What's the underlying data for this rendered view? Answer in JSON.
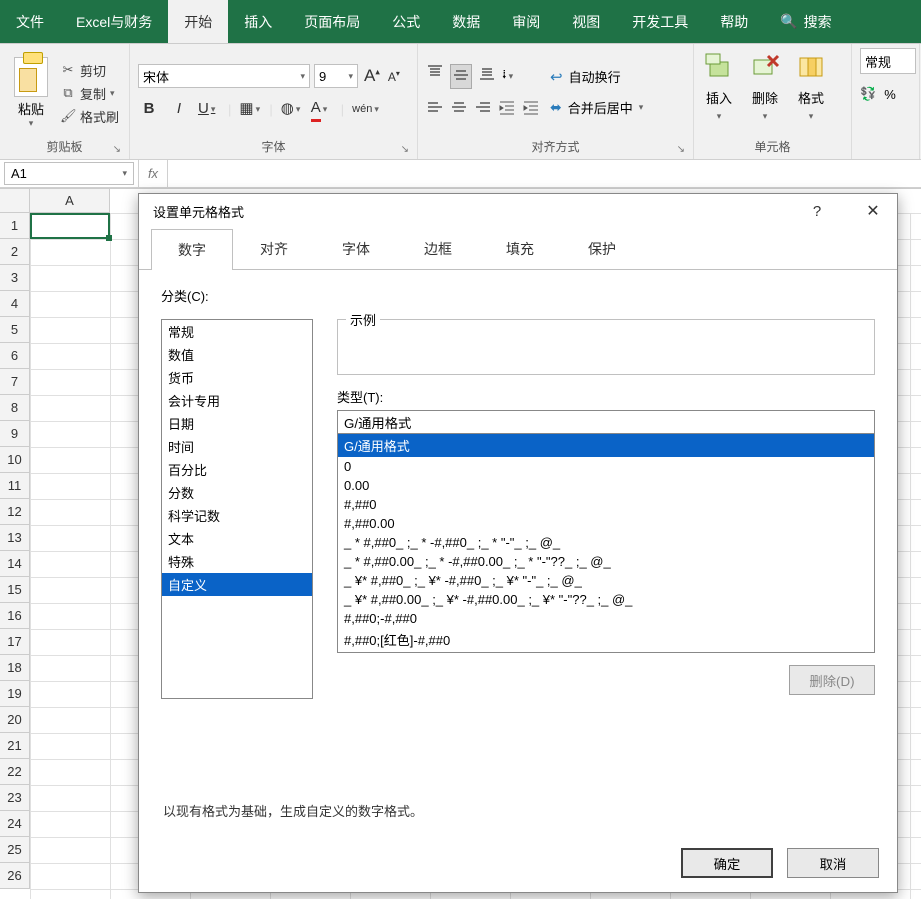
{
  "tabs": {
    "file": "文件",
    "addon": "Excel与财务",
    "home": "开始",
    "insert": "插入",
    "layout": "页面布局",
    "formula": "公式",
    "data": "数据",
    "review": "审阅",
    "view": "视图",
    "dev": "开发工具",
    "help": "帮助",
    "search": "搜索"
  },
  "ribbon": {
    "clipboard": {
      "paste": "粘贴",
      "cut": "剪切",
      "copy": "复制",
      "formatPainter": "格式刷",
      "label": "剪贴板"
    },
    "font": {
      "name": "宋体",
      "size": "9",
      "bold": "B",
      "italic": "I",
      "underline": "U",
      "label": "字体",
      "phonetic": "wén"
    },
    "align": {
      "wrap": "自动换行",
      "merge": "合并后居中",
      "label": "对齐方式"
    },
    "cells": {
      "insert": "插入",
      "delete": "删除",
      "format": "格式",
      "label": "单元格"
    },
    "number": {
      "general": "常规",
      "percent": "%"
    }
  },
  "nameBox": "A1",
  "columns": [
    "A"
  ],
  "rows": [
    "1",
    "2",
    "3",
    "4",
    "5",
    "6",
    "7",
    "8",
    "9",
    "10",
    "11",
    "12",
    "13",
    "14",
    "15",
    "16",
    "17",
    "18",
    "19",
    "20",
    "21",
    "22",
    "23",
    "24",
    "25",
    "26"
  ],
  "dialog": {
    "title": "设置单元格格式",
    "help": "?",
    "tabs": {
      "number": "数字",
      "alignment": "对齐",
      "font": "字体",
      "border": "边框",
      "fill": "填充",
      "protection": "保护"
    },
    "categoryLabel": "分类(C):",
    "categories": [
      "常规",
      "数值",
      "货币",
      "会计专用",
      "日期",
      "时间",
      "百分比",
      "分数",
      "科学记数",
      "文本",
      "特殊",
      "自定义"
    ],
    "selectedCategoryIndex": 11,
    "sampleLabel": "示例",
    "typeLabel": "类型(T):",
    "typeValue": "G/通用格式",
    "typeList": [
      "G/通用格式",
      "0",
      "0.00",
      "#,##0",
      "#,##0.00",
      "_ * #,##0_ ;_ * -#,##0_ ;_ * \"-\"_ ;_ @_ ",
      "_ * #,##0.00_ ;_ * -#,##0.00_ ;_ * \"-\"??_ ;_ @_ ",
      "_ ¥* #,##0_ ;_ ¥* -#,##0_ ;_ ¥* \"-\"_ ;_ @_ ",
      "_ ¥* #,##0.00_ ;_ ¥* -#,##0.00_ ;_ ¥* \"-\"??_ ;_ @_ ",
      "#,##0;-#,##0",
      "#,##0;[红色]-#,##0"
    ],
    "selectedTypeIndex": 0,
    "deleteLabel": "删除(D)",
    "hint": "以现有格式为基础，生成自定义的数字格式。",
    "ok": "确定",
    "cancel": "取消"
  }
}
